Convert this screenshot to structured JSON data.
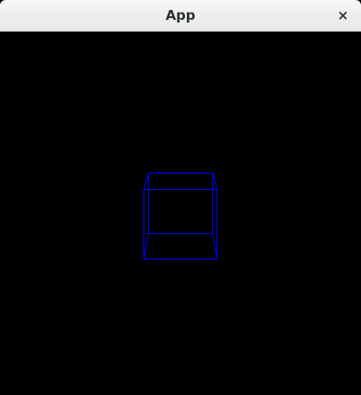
{
  "window": {
    "title": "App",
    "close_glyph": "×"
  },
  "scene": {
    "background_color": "#000000",
    "object": "wireframe-cube",
    "line_color": "#0000ff"
  }
}
